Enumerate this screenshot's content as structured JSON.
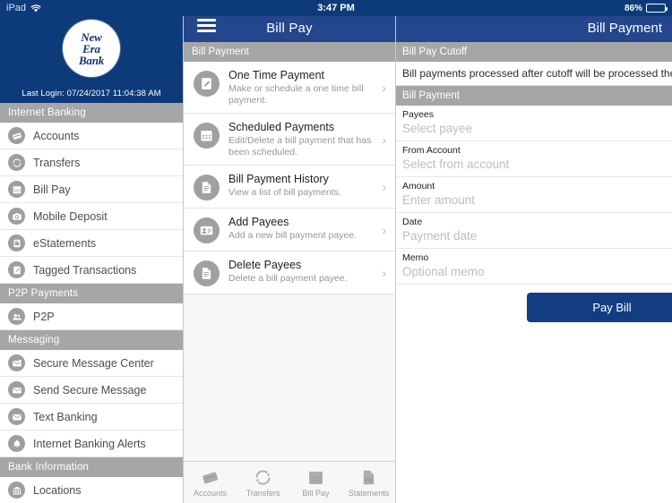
{
  "statusbar": {
    "device": "iPad",
    "wifi_icon": "wifi-icon",
    "time": "3:47 PM",
    "battery_percent": "86%",
    "battery_level": 86
  },
  "sidebar": {
    "brand": {
      "logo_line1": "New",
      "logo_line2": "Era",
      "logo_line3": "Bank",
      "last_login": "Last Login: 07/24/2017 11:04:38 AM"
    },
    "sections": [
      {
        "header": "Internet Banking",
        "items": [
          {
            "label": "Accounts",
            "icon": "cards-icon"
          },
          {
            "label": "Transfers",
            "icon": "refresh-arrows-icon"
          },
          {
            "label": "Bill Pay",
            "icon": "calendar-icon"
          },
          {
            "label": "Mobile Deposit",
            "icon": "camera-icon"
          },
          {
            "label": "eStatements",
            "icon": "document-printer-icon"
          },
          {
            "label": "Tagged Transactions",
            "icon": "tag-pencil-icon"
          }
        ]
      },
      {
        "header": "P2P Payments",
        "items": [
          {
            "label": "P2P",
            "icon": "people-icon"
          }
        ]
      },
      {
        "header": "Messaging",
        "items": [
          {
            "label": "Secure Message Center",
            "icon": "envelope-badge-icon"
          },
          {
            "label": "Send Secure Message",
            "icon": "envelope-icon"
          },
          {
            "label": "Text Banking",
            "icon": "envelope-icon"
          },
          {
            "label": "Internet Banking Alerts",
            "icon": "bell-icon"
          }
        ]
      },
      {
        "header": "Bank Information",
        "items": [
          {
            "label": "Locations",
            "icon": "bank-building-icon"
          }
        ]
      }
    ]
  },
  "middle": {
    "menu_icon": "hamburger-menu-icon",
    "title": "Bill Pay",
    "section_header": "Bill Payment",
    "rows": [
      {
        "title": "One Time Payment",
        "subtitle": "Make or schedule a one time bill payment.",
        "icon": "pencil-edit-icon",
        "chevron": "chevron-right-icon"
      },
      {
        "title": "Scheduled Payments",
        "subtitle": "Edit/Delete a bill payment that has been scheduled.",
        "icon": "calendar-icon",
        "chevron": "chevron-right-icon"
      },
      {
        "title": "Bill Payment History",
        "subtitle": "View a list of bill payments.",
        "icon": "document-list-icon",
        "chevron": "chevron-right-icon"
      },
      {
        "title": "Add Payees",
        "subtitle": "Add a new bill payment payee.",
        "icon": "contact-card-icon",
        "chevron": "chevron-right-icon"
      },
      {
        "title": "Delete Payees",
        "subtitle": "Delete a bill payment payee.",
        "icon": "document-list-icon",
        "chevron": "chevron-right-icon"
      }
    ],
    "tabs": [
      {
        "label": "Accounts",
        "icon": "cards-icon"
      },
      {
        "label": "Transfers",
        "icon": "refresh-arrows-icon"
      },
      {
        "label": "Bill Pay",
        "icon": "calendar-icon"
      },
      {
        "label": "Statements",
        "icon": "pdf-document-icon"
      }
    ]
  },
  "right": {
    "title": "Bill Payment",
    "cutoff_header": "Bill Pay Cutoff",
    "cutoff_note": "Bill payments processed after cutoff will be processed the next business day.",
    "form_header": "Bill Payment",
    "fields": [
      {
        "label": "Payees",
        "placeholder": "Select payee",
        "value": ""
      },
      {
        "label": "From Account",
        "placeholder": "Select from account",
        "value": ""
      },
      {
        "label": "Amount",
        "placeholder": "Enter amount",
        "value": ""
      },
      {
        "label": "Date",
        "placeholder": "Payment date",
        "value": ""
      },
      {
        "label": "Memo",
        "placeholder": "Optional memo",
        "value": ""
      }
    ],
    "submit_label": "Pay Bill"
  },
  "colors": {
    "brand_navy": "#0d3b7a",
    "navbar_blue": "#24468c",
    "section_gray": "#a6a6a6",
    "button_blue": "#123d80",
    "icon_gray": "#9e9e9e"
  }
}
